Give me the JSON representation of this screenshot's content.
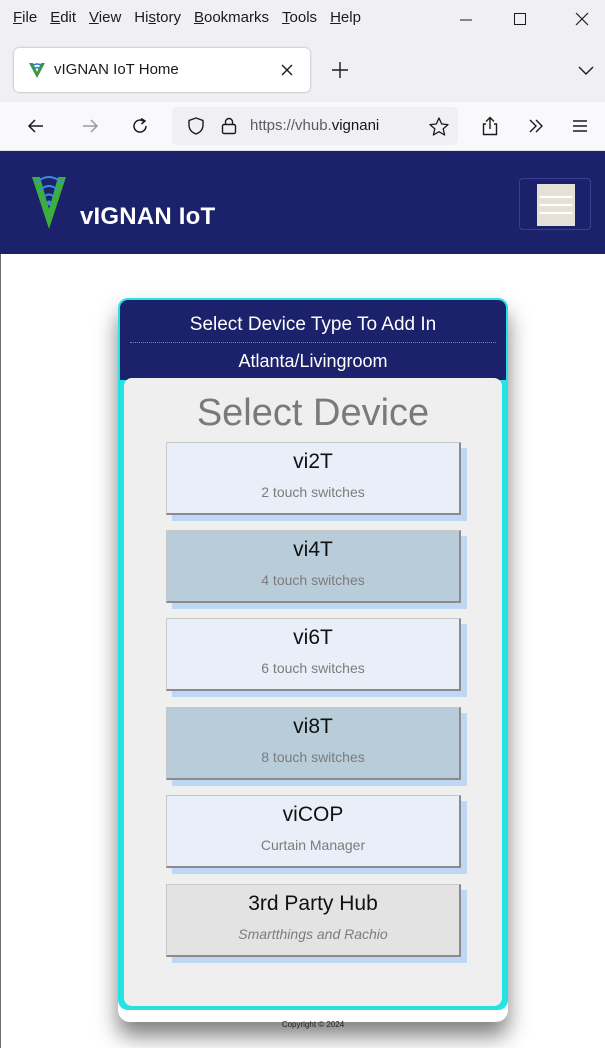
{
  "menu": {
    "items": [
      {
        "ul": "F",
        "rest": "ile"
      },
      {
        "ul": "E",
        "rest": "dit"
      },
      {
        "ul": "V",
        "rest": "iew"
      },
      {
        "pre": "Hi",
        "ul": "s",
        "rest": "tory"
      },
      {
        "ul": "B",
        "rest": "ookmarks"
      },
      {
        "ul": "T",
        "rest": "ools"
      },
      {
        "ul": "H",
        "rest": "elp"
      }
    ]
  },
  "tab": {
    "title": "vIGNAN IoT Home",
    "favicon": "vignan-logo-icon"
  },
  "navbar": {
    "url_prefix": "https://vhub.",
    "url_domain": "vignani"
  },
  "site": {
    "title": "vIGNAN IoT"
  },
  "dialog": {
    "header_line1": "Select Device Type To Add In",
    "header_line2": "Atlanta/Livingroom",
    "heading": "Select Device",
    "devices": [
      {
        "name": "vi2T",
        "desc": "2 touch switches"
      },
      {
        "name": "vi4T",
        "desc": "4 touch switches"
      },
      {
        "name": "vi6T",
        "desc": "6 touch switches"
      },
      {
        "name": "vi8T",
        "desc": "8 touch switches"
      },
      {
        "name": "viCOP",
        "desc": "Curtain Manager"
      },
      {
        "name": "3rd Party Hub",
        "desc": "Smartthings and Rachio"
      }
    ]
  },
  "footer": {
    "copyright": "Copyright © 2024"
  },
  "colors": {
    "header_navy": "#1b216a",
    "card_cyan": "#26e3e3",
    "button_light": "#e8eff8",
    "button_dark": "#b8ccd9",
    "button_gray": "#e3e3e3",
    "button_shadow": "#bed7f5"
  }
}
